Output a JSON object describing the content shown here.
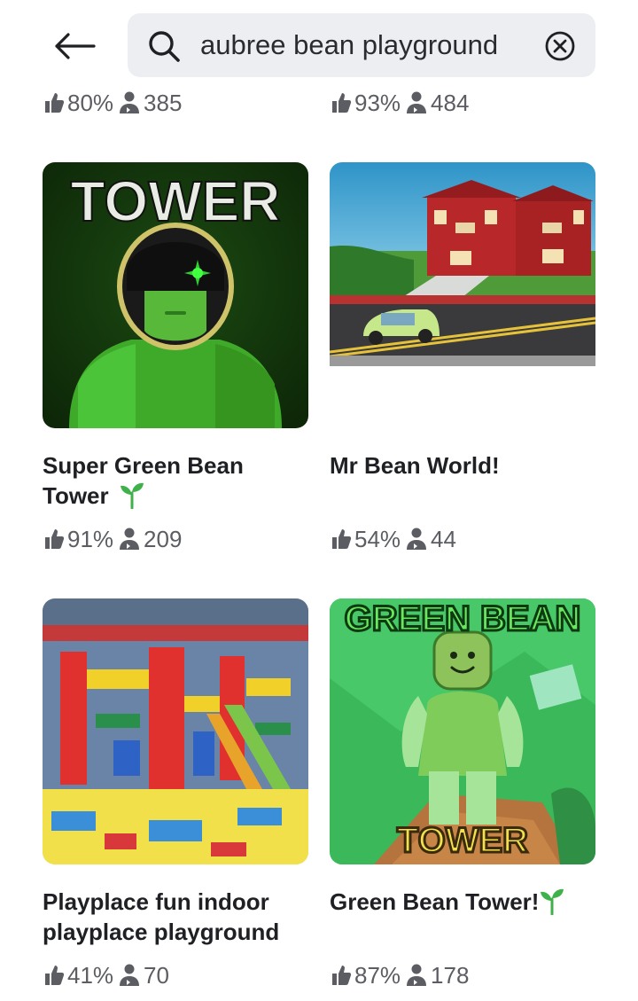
{
  "search": {
    "query": "aubree bean playground"
  },
  "icons": {
    "back": "back-arrow-icon",
    "search": "search-icon",
    "clear": "clear-circle-x-icon",
    "like": "thumbs-up-icon",
    "players": "players-icon",
    "sprout": "sprout-icon"
  },
  "colors": {
    "text_primary": "#1f2024",
    "text_secondary": "#5b5d63",
    "search_bg": "#eceef1",
    "sprout_green": "#3fb14a"
  },
  "partial_row": [
    {
      "rating": "80%",
      "players": "385"
    },
    {
      "rating": "93%",
      "players": "484"
    }
  ],
  "games": [
    {
      "title_line1": "Super Green Bean",
      "title_line2": "Tower",
      "sprout": true,
      "rating": "91%",
      "players": "209",
      "thumb_text": "TOWER"
    },
    {
      "title_line1": "Mr Bean World!",
      "title_line2": "",
      "sprout": false,
      "rating": "54%",
      "players": "44"
    },
    {
      "title_line1": "Playplace fun indoor",
      "title_line2": "playplace playground",
      "sprout": false,
      "rating": "41%",
      "players": "70"
    },
    {
      "title_line1": "Green Bean Tower!",
      "title_line2": "",
      "sprout": true,
      "rating": "87%",
      "players": "178",
      "thumb_text_top": "GREEN BEAN",
      "thumb_text_bottom": "TOWER"
    }
  ]
}
